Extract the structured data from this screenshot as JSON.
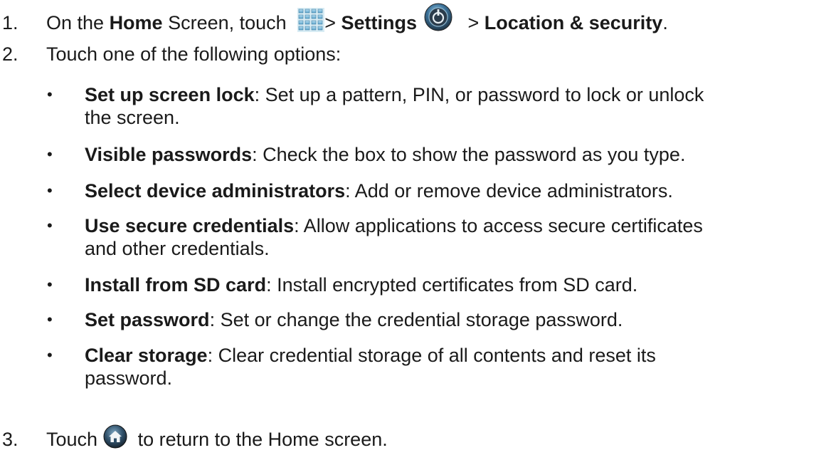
{
  "step1": {
    "number": "1.",
    "prefix": "On the ",
    "home": "Home",
    "screen_touch": " Screen, touch ",
    "sep1": "> ",
    "settings": "Settings",
    "sep2": " > ",
    "location_security": "Location & security",
    "period": "."
  },
  "step2": {
    "number": "2.",
    "text": "Touch one of the following options:"
  },
  "options": [
    {
      "label": "Set up screen lock",
      "desc": ": Set up a pattern, PIN, or password to lock or unlock",
      "desc2": "the screen."
    },
    {
      "label": "Visible passwords",
      "desc": ": Check the box to show the password as you type.",
      "desc2": ""
    },
    {
      "label": "Select device administrators",
      "desc": ": Add or remove device administrators.",
      "desc2": ""
    },
    {
      "label": "Use secure credentials",
      "desc": ": Allow applications to access secure certificates",
      "desc2": "and other credentials."
    },
    {
      "label": "Install from SD card",
      "desc": ": Install encrypted certificates from SD card.",
      "desc2": ""
    },
    {
      "label": "Set password",
      "desc": ": Set or change the credential storage password.",
      "desc2": ""
    },
    {
      "label": "Clear storage",
      "desc": ": Clear credential storage of all contents and reset its",
      "desc2": "password."
    }
  ],
  "bullet_char": "•",
  "step3": {
    "number": "3.",
    "prefix": "Touch ",
    "suffix": "  to return to the Home screen."
  },
  "icons": {
    "apps": "apps-grid-icon",
    "settings": "settings-icon",
    "home": "home-icon"
  }
}
